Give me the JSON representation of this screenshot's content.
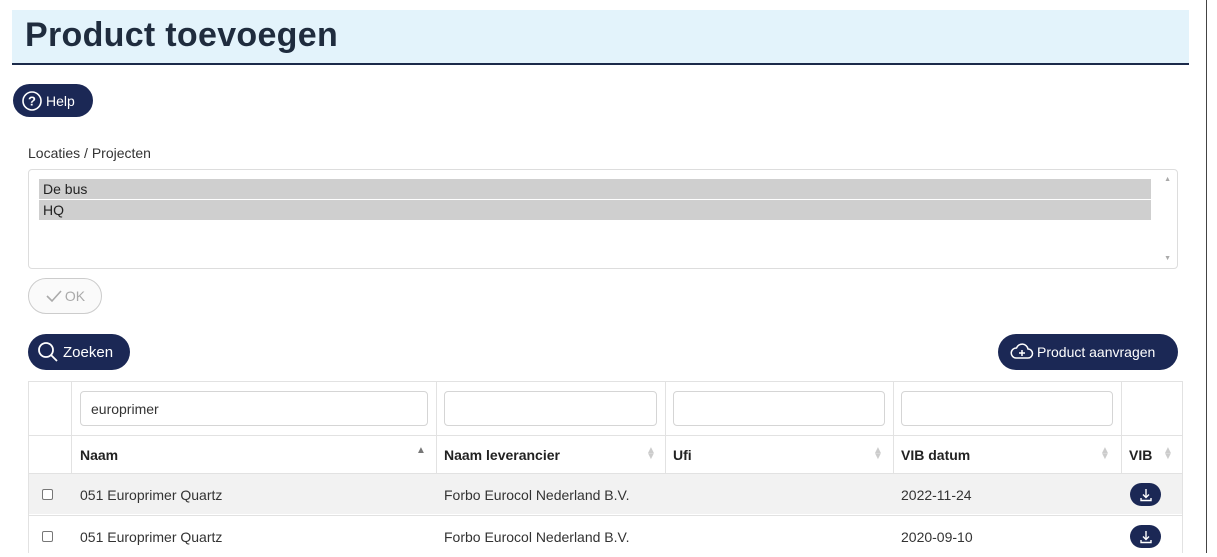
{
  "page": {
    "title": "Product toevoegen"
  },
  "help": {
    "label": "Help",
    "icon": "help-circle-icon"
  },
  "locations": {
    "label": "Locaties / Projecten",
    "options": [
      "De bus",
      "HQ"
    ]
  },
  "ok": {
    "label": "OK",
    "icon": "checkmark-icon"
  },
  "search": {
    "label": "Zoeken",
    "icon": "search-icon"
  },
  "request": {
    "label": "Product aanvragen",
    "icon": "cloud-upload-icon"
  },
  "table": {
    "filters": {
      "naam": "europrimer",
      "leverancier": "",
      "ufi": "",
      "vib_datum": ""
    },
    "columns": [
      "Naam",
      "Naam leverancier",
      "Ufi",
      "VIB datum",
      "VIB"
    ],
    "sorted_column": "Naam",
    "rows": [
      {
        "naam": "051 Europrimer Quartz",
        "leverancier": "Forbo Eurocol Nederland B.V.",
        "ufi": "",
        "vib_datum": "2022-11-24",
        "vib_icon": "download-icon"
      },
      {
        "naam": "051 Europrimer Quartz",
        "leverancier": "Forbo Eurocol Nederland B.V.",
        "ufi": "",
        "vib_datum": "2020-09-10",
        "vib_icon": "download-icon"
      }
    ]
  },
  "colors": {
    "primary": "#1b2855",
    "header_bg": "#e3f3fb",
    "selected_option": "#cfcfcf",
    "row_stripe": "#f2f2f2"
  }
}
